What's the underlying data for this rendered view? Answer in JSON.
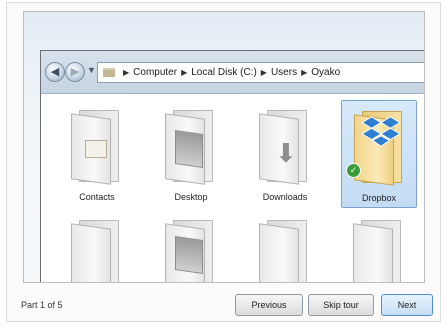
{
  "address": {
    "crumbs": [
      "Computer",
      "Local Disk (C:)",
      "Users",
      "Oyako"
    ]
  },
  "folders": [
    {
      "label": "Contacts"
    },
    {
      "label": "Desktop"
    },
    {
      "label": "Downloads"
    },
    {
      "label": "Dropbox",
      "selected": true
    }
  ],
  "footer": {
    "part_label": "Part 1 of 5",
    "previous_label": "Previous",
    "skip_label": "Skip tour",
    "next_label": "Next"
  },
  "colors": {
    "selection": "#c3dcf3",
    "dropbox_blue": "#2f7fd1",
    "check_green": "#3a9b3a"
  }
}
